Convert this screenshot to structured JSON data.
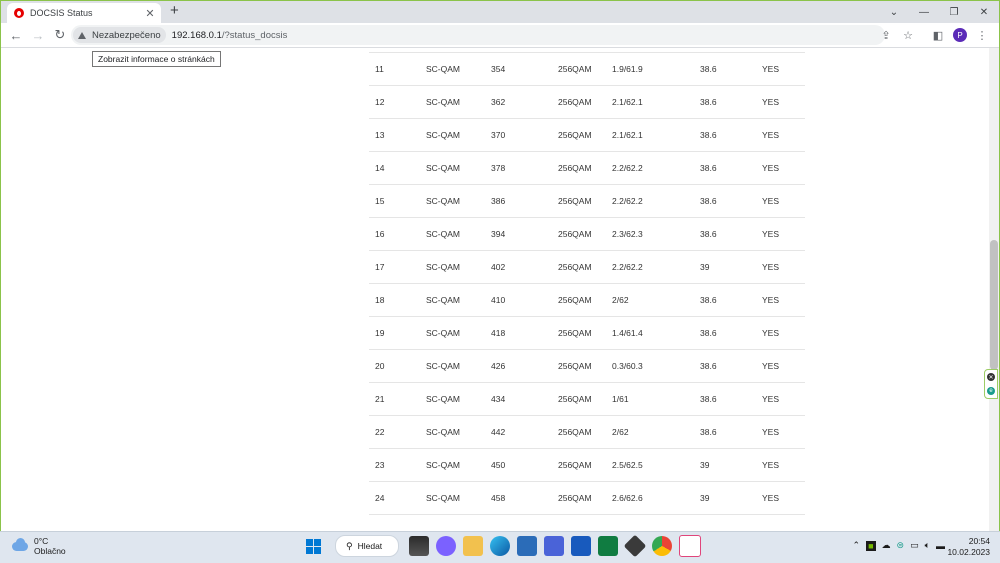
{
  "browser": {
    "tab_title": "DOCSIS Status",
    "tab_close": "✕",
    "new_tab": "+",
    "window_controls": {
      "minimize": "—",
      "maximize": "❐",
      "close": "✕"
    },
    "toolbar": {
      "back": "←",
      "forward": "→",
      "reload": "↻"
    },
    "security_label": "Nezabezpečeno",
    "url_host": "192.168.0.1",
    "url_path": "/?status_docsis",
    "tooltip": "Zobrazit informace o stránkách",
    "profile_initial": "P"
  },
  "table": {
    "rows": [
      [
        "11",
        "SC-QAM",
        "354",
        "256QAM",
        "1.9/61.9",
        "38.6",
        "YES"
      ],
      [
        "12",
        "SC-QAM",
        "362",
        "256QAM",
        "2.1/62.1",
        "38.6",
        "YES"
      ],
      [
        "13",
        "SC-QAM",
        "370",
        "256QAM",
        "2.1/62.1",
        "38.6",
        "YES"
      ],
      [
        "14",
        "SC-QAM",
        "378",
        "256QAM",
        "2.2/62.2",
        "38.6",
        "YES"
      ],
      [
        "15",
        "SC-QAM",
        "386",
        "256QAM",
        "2.2/62.2",
        "38.6",
        "YES"
      ],
      [
        "16",
        "SC-QAM",
        "394",
        "256QAM",
        "2.3/62.3",
        "38.6",
        "YES"
      ],
      [
        "17",
        "SC-QAM",
        "402",
        "256QAM",
        "2.2/62.2",
        "39",
        "YES"
      ],
      [
        "18",
        "SC-QAM",
        "410",
        "256QAM",
        "2/62",
        "38.6",
        "YES"
      ],
      [
        "19",
        "SC-QAM",
        "418",
        "256QAM",
        "1.4/61.4",
        "38.6",
        "YES"
      ],
      [
        "20",
        "SC-QAM",
        "426",
        "256QAM",
        "0.3/60.3",
        "38.6",
        "YES"
      ],
      [
        "21",
        "SC-QAM",
        "434",
        "256QAM",
        "1/61",
        "38.6",
        "YES"
      ],
      [
        "22",
        "SC-QAM",
        "442",
        "256QAM",
        "2/62",
        "38.6",
        "YES"
      ],
      [
        "23",
        "SC-QAM",
        "450",
        "256QAM",
        "2.5/62.5",
        "39",
        "YES"
      ],
      [
        "24",
        "SC-QAM",
        "458",
        "256QAM",
        "2.6/62.6",
        "39",
        "YES"
      ]
    ]
  },
  "taskbar": {
    "weather_temp": "0°C",
    "weather_desc": "Oblačno",
    "search_label": "Hledat",
    "time": "20:54",
    "date": "10.02.2023"
  },
  "colors": {
    "vodafone_red": "#e60000",
    "window_border": "#8bc34a",
    "windows_blue": "#0078d4"
  }
}
